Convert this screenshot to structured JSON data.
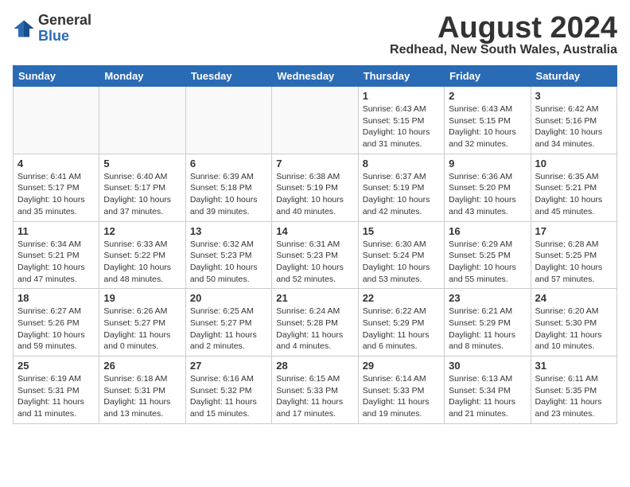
{
  "header": {
    "logo_general": "General",
    "logo_blue": "Blue",
    "month": "August 2024",
    "location": "Redhead, New South Wales, Australia"
  },
  "weekdays": [
    "Sunday",
    "Monday",
    "Tuesday",
    "Wednesday",
    "Thursday",
    "Friday",
    "Saturday"
  ],
  "weeks": [
    [
      {
        "day": "",
        "info": ""
      },
      {
        "day": "",
        "info": ""
      },
      {
        "day": "",
        "info": ""
      },
      {
        "day": "",
        "info": ""
      },
      {
        "day": "1",
        "info": "Sunrise: 6:43 AM\nSunset: 5:15 PM\nDaylight: 10 hours\nand 31 minutes."
      },
      {
        "day": "2",
        "info": "Sunrise: 6:43 AM\nSunset: 5:15 PM\nDaylight: 10 hours\nand 32 minutes."
      },
      {
        "day": "3",
        "info": "Sunrise: 6:42 AM\nSunset: 5:16 PM\nDaylight: 10 hours\nand 34 minutes."
      }
    ],
    [
      {
        "day": "4",
        "info": "Sunrise: 6:41 AM\nSunset: 5:17 PM\nDaylight: 10 hours\nand 35 minutes."
      },
      {
        "day": "5",
        "info": "Sunrise: 6:40 AM\nSunset: 5:17 PM\nDaylight: 10 hours\nand 37 minutes."
      },
      {
        "day": "6",
        "info": "Sunrise: 6:39 AM\nSunset: 5:18 PM\nDaylight: 10 hours\nand 39 minutes."
      },
      {
        "day": "7",
        "info": "Sunrise: 6:38 AM\nSunset: 5:19 PM\nDaylight: 10 hours\nand 40 minutes."
      },
      {
        "day": "8",
        "info": "Sunrise: 6:37 AM\nSunset: 5:19 PM\nDaylight: 10 hours\nand 42 minutes."
      },
      {
        "day": "9",
        "info": "Sunrise: 6:36 AM\nSunset: 5:20 PM\nDaylight: 10 hours\nand 43 minutes."
      },
      {
        "day": "10",
        "info": "Sunrise: 6:35 AM\nSunset: 5:21 PM\nDaylight: 10 hours\nand 45 minutes."
      }
    ],
    [
      {
        "day": "11",
        "info": "Sunrise: 6:34 AM\nSunset: 5:21 PM\nDaylight: 10 hours\nand 47 minutes."
      },
      {
        "day": "12",
        "info": "Sunrise: 6:33 AM\nSunset: 5:22 PM\nDaylight: 10 hours\nand 48 minutes."
      },
      {
        "day": "13",
        "info": "Sunrise: 6:32 AM\nSunset: 5:23 PM\nDaylight: 10 hours\nand 50 minutes."
      },
      {
        "day": "14",
        "info": "Sunrise: 6:31 AM\nSunset: 5:23 PM\nDaylight: 10 hours\nand 52 minutes."
      },
      {
        "day": "15",
        "info": "Sunrise: 6:30 AM\nSunset: 5:24 PM\nDaylight: 10 hours\nand 53 minutes."
      },
      {
        "day": "16",
        "info": "Sunrise: 6:29 AM\nSunset: 5:25 PM\nDaylight: 10 hours\nand 55 minutes."
      },
      {
        "day": "17",
        "info": "Sunrise: 6:28 AM\nSunset: 5:25 PM\nDaylight: 10 hours\nand 57 minutes."
      }
    ],
    [
      {
        "day": "18",
        "info": "Sunrise: 6:27 AM\nSunset: 5:26 PM\nDaylight: 10 hours\nand 59 minutes."
      },
      {
        "day": "19",
        "info": "Sunrise: 6:26 AM\nSunset: 5:27 PM\nDaylight: 11 hours\nand 0 minutes."
      },
      {
        "day": "20",
        "info": "Sunrise: 6:25 AM\nSunset: 5:27 PM\nDaylight: 11 hours\nand 2 minutes."
      },
      {
        "day": "21",
        "info": "Sunrise: 6:24 AM\nSunset: 5:28 PM\nDaylight: 11 hours\nand 4 minutes."
      },
      {
        "day": "22",
        "info": "Sunrise: 6:22 AM\nSunset: 5:29 PM\nDaylight: 11 hours\nand 6 minutes."
      },
      {
        "day": "23",
        "info": "Sunrise: 6:21 AM\nSunset: 5:29 PM\nDaylight: 11 hours\nand 8 minutes."
      },
      {
        "day": "24",
        "info": "Sunrise: 6:20 AM\nSunset: 5:30 PM\nDaylight: 11 hours\nand 10 minutes."
      }
    ],
    [
      {
        "day": "25",
        "info": "Sunrise: 6:19 AM\nSunset: 5:31 PM\nDaylight: 11 hours\nand 11 minutes."
      },
      {
        "day": "26",
        "info": "Sunrise: 6:18 AM\nSunset: 5:31 PM\nDaylight: 11 hours\nand 13 minutes."
      },
      {
        "day": "27",
        "info": "Sunrise: 6:16 AM\nSunset: 5:32 PM\nDaylight: 11 hours\nand 15 minutes."
      },
      {
        "day": "28",
        "info": "Sunrise: 6:15 AM\nSunset: 5:33 PM\nDaylight: 11 hours\nand 17 minutes."
      },
      {
        "day": "29",
        "info": "Sunrise: 6:14 AM\nSunset: 5:33 PM\nDaylight: 11 hours\nand 19 minutes."
      },
      {
        "day": "30",
        "info": "Sunrise: 6:13 AM\nSunset: 5:34 PM\nDaylight: 11 hours\nand 21 minutes."
      },
      {
        "day": "31",
        "info": "Sunrise: 6:11 AM\nSunset: 5:35 PM\nDaylight: 11 hours\nand 23 minutes."
      }
    ]
  ]
}
